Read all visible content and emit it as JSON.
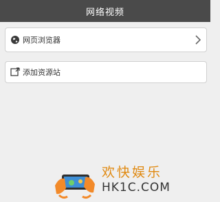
{
  "header": {
    "title": "网络视频"
  },
  "items": [
    {
      "label": "网页浏览器",
      "icon": "globe-icon",
      "has_chevron": true
    },
    {
      "label": "添加资源站",
      "icon": "add-source-icon",
      "has_chevron": false
    }
  ],
  "watermark": {
    "title": "欢快娱乐",
    "domain": "HK1C.COM"
  },
  "colors": {
    "header_bg": "#4a4a4a",
    "page_bg": "#efefef",
    "watermark_title": "#e08a12"
  }
}
